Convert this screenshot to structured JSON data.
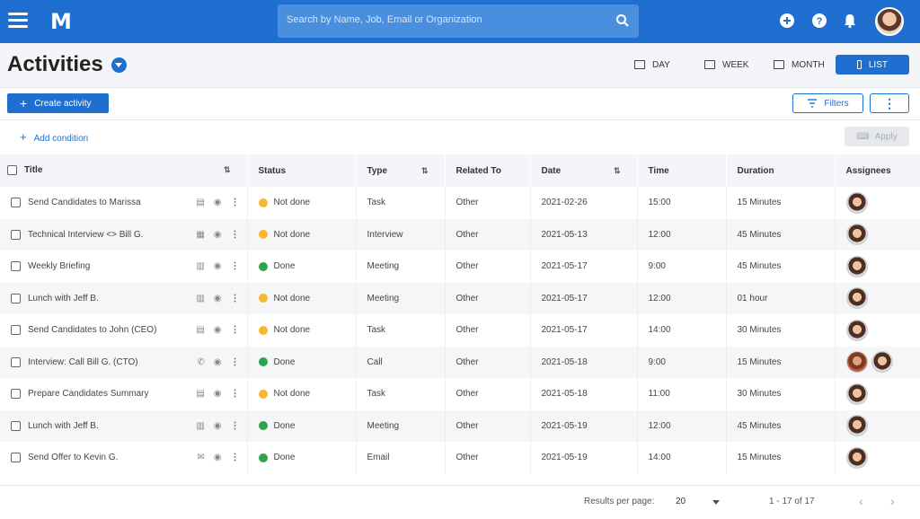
{
  "topbar": {
    "logo": "M",
    "search_placeholder": "Search by Name, Job, Email or Organization",
    "icons": [
      "menu-icon",
      "search-icon",
      "add-icon",
      "help-icon",
      "bell-icon"
    ],
    "brand_color": "#1e6fd0"
  },
  "header": {
    "title": "Activities",
    "views": [
      {
        "label": "DAY",
        "icon": "day-icon",
        "active": false
      },
      {
        "label": "WEEK",
        "icon": "week-icon",
        "active": false
      },
      {
        "label": "MONTH",
        "icon": "month-icon",
        "active": false
      },
      {
        "label": "LIST",
        "icon": "list-icon",
        "active": true
      }
    ]
  },
  "toolbar": {
    "create_label": "Create activity",
    "filters_label": "Filters",
    "more_label": "⋮",
    "add_condition_label": "Add condition",
    "apply_label": "Apply"
  },
  "table": {
    "columns": [
      "Title",
      "Status",
      "Type",
      "Related To",
      "Date",
      "Time",
      "Duration",
      "Assignees"
    ],
    "status_colors": {
      "Not done": "#f5b82e",
      "Done": "#2ea44f"
    },
    "rows": [
      {
        "title": "Send Candidates to Marissa",
        "status": "Not done",
        "type": "Task",
        "related": "Other",
        "date": "2021-02-26",
        "time": "15:00",
        "duration": "15 Minutes",
        "assignees": 1
      },
      {
        "title": "Technical Interview <> Bill G.",
        "status": "Not done",
        "type": "Interview",
        "related": "Other",
        "date": "2021-05-13",
        "time": "12:00",
        "duration": "45 Minutes",
        "assignees": 1
      },
      {
        "title": "Weekly Briefing",
        "status": "Done",
        "type": "Meeting",
        "related": "Other",
        "date": "2021-05-17",
        "time": "9:00",
        "duration": "45 Minutes",
        "assignees": 1
      },
      {
        "title": "Lunch with Jeff B.",
        "status": "Not done",
        "type": "Meeting",
        "related": "Other",
        "date": "2021-05-17",
        "time": "12:00",
        "duration": "01 hour",
        "assignees": 1
      },
      {
        "title": "Send Candidates to John (CEO)",
        "status": "Not done",
        "type": "Task",
        "related": "Other",
        "date": "2021-05-17",
        "time": "14:00",
        "duration": "30 Minutes",
        "assignees": 1
      },
      {
        "title": "Interview: Call Bill G. (CTO)",
        "status": "Done",
        "type": "Call",
        "related": "Other",
        "date": "2021-05-18",
        "time": "9:00",
        "duration": "15 Minutes",
        "assignees": 2
      },
      {
        "title": "Prepare Candidates Summary",
        "status": "Not done",
        "type": "Task",
        "related": "Other",
        "date": "2021-05-18",
        "time": "11:00",
        "duration": "30 Minutes",
        "assignees": 1
      },
      {
        "title": "Lunch with Jeff B.",
        "status": "Done",
        "type": "Meeting",
        "related": "Other",
        "date": "2021-05-19",
        "time": "12:00",
        "duration": "45 Minutes",
        "assignees": 1
      },
      {
        "title": "Send Offer to Kevin G.",
        "status": "Done",
        "type": "Email",
        "related": "Other",
        "date": "2021-05-19",
        "time": "14:00",
        "duration": "15 Minutes",
        "assignees": 1
      }
    ]
  },
  "footer": {
    "results_label": "Results per page:",
    "per_page": "20",
    "range": "1 - 17 of 17",
    "prev": "‹",
    "next": "›"
  }
}
